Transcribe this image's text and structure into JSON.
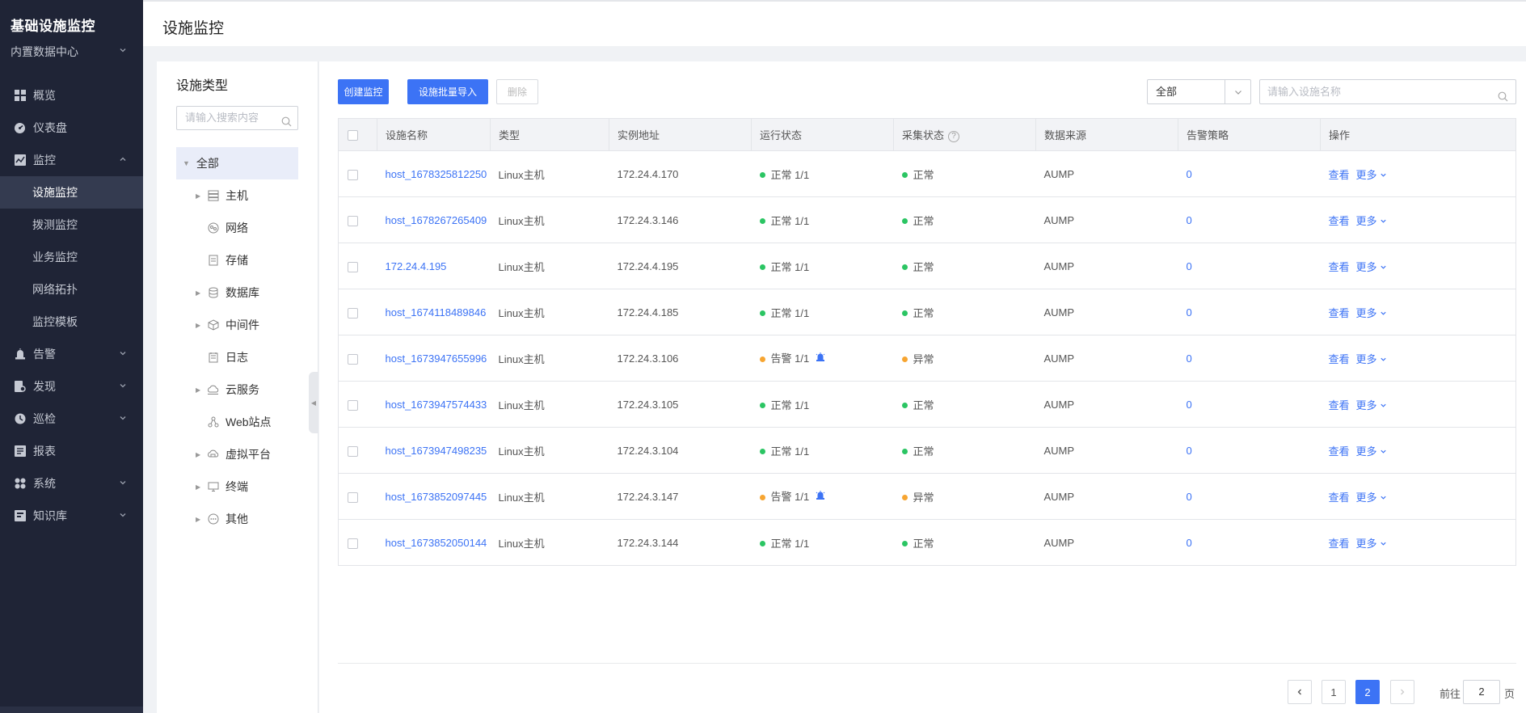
{
  "sidebar": {
    "title": "基础设施监控",
    "datacenter": "内置数据中心",
    "items": [
      {
        "label": "概览",
        "icon": "grid-icon",
        "expandable": false
      },
      {
        "label": "仪表盘",
        "icon": "dashboard-icon",
        "expandable": false
      },
      {
        "label": "监控",
        "icon": "monitor-chart-icon",
        "expandable": true,
        "open": true
      },
      {
        "label": "告警",
        "icon": "alarm-light-icon",
        "expandable": true
      },
      {
        "label": "发现",
        "icon": "discover-icon",
        "expandable": true
      },
      {
        "label": "巡检",
        "icon": "inspect-icon",
        "expandable": true
      },
      {
        "label": "报表",
        "icon": "report-icon",
        "expandable": false
      },
      {
        "label": "系统",
        "icon": "system-icon",
        "expandable": true
      },
      {
        "label": "知识库",
        "icon": "knowledge-icon",
        "expandable": true
      }
    ],
    "monitor_sub": [
      "设施监控",
      "拨测监控",
      "业务监控",
      "网络拓扑",
      "监控模板"
    ],
    "active_sub": "设施监控"
  },
  "header": {
    "title": "设施监控"
  },
  "tree": {
    "title": "设施类型",
    "search_placeholder": "请输入搜索内容",
    "root": "全部",
    "nodes": [
      {
        "label": "主机",
        "icon": "server-icon",
        "expandable": true
      },
      {
        "label": "网络",
        "icon": "network-icon",
        "expandable": false
      },
      {
        "label": "存储",
        "icon": "storage-icon",
        "expandable": false
      },
      {
        "label": "数据库",
        "icon": "database-icon",
        "expandable": true
      },
      {
        "label": "中间件",
        "icon": "middleware-icon",
        "expandable": true
      },
      {
        "label": "日志",
        "icon": "log-icon",
        "expandable": false
      },
      {
        "label": "云服务",
        "icon": "cloud-icon",
        "expandable": true
      },
      {
        "label": "Web站点",
        "icon": "web-site-icon",
        "expandable": false
      },
      {
        "label": "虚拟平台",
        "icon": "virtual-platform-icon",
        "expandable": true
      },
      {
        "label": "终端",
        "icon": "terminal-icon",
        "expandable": true
      },
      {
        "label": "其他",
        "icon": "more-dots-icon",
        "expandable": true
      }
    ]
  },
  "toolbar": {
    "create_label": "创建监控",
    "import_label": "设施批量导入",
    "delete_label": "删除",
    "filter_value": "全部",
    "search_placeholder": "请输入设施名称"
  },
  "table": {
    "columns": [
      "设施名称",
      "类型",
      "实例地址",
      "运行状态",
      "采集状态",
      "数据来源",
      "告警策略",
      "操作"
    ],
    "view_label": "查看",
    "more_label": "更多",
    "rows": [
      {
        "name": "host_1678325812250",
        "type": "Linux主机",
        "address": "172.24.4.170",
        "run_status": "正常 1/1",
        "run_level": "ok",
        "collect_status": "正常",
        "collect_level": "ok",
        "source": "AUMP",
        "policy": "0"
      },
      {
        "name": "host_1678267265409",
        "type": "Linux主机",
        "address": "172.24.3.146",
        "run_status": "正常 1/1",
        "run_level": "ok",
        "collect_status": "正常",
        "collect_level": "ok",
        "source": "AUMP",
        "policy": "0"
      },
      {
        "name": "172.24.4.195",
        "type": "Linux主机",
        "address": "172.24.4.195",
        "run_status": "正常 1/1",
        "run_level": "ok",
        "collect_status": "正常",
        "collect_level": "ok",
        "source": "AUMP",
        "policy": "0"
      },
      {
        "name": "host_1674118489846",
        "type": "Linux主机",
        "address": "172.24.4.185",
        "run_status": "正常 1/1",
        "run_level": "ok",
        "collect_status": "正常",
        "collect_level": "ok",
        "source": "AUMP",
        "policy": "0"
      },
      {
        "name": "host_1673947655996",
        "type": "Linux主机",
        "address": "172.24.3.106",
        "run_status": "告警 1/1",
        "run_level": "warn",
        "collect_status": "异常",
        "collect_level": "warn",
        "source": "AUMP",
        "policy": "0"
      },
      {
        "name": "host_1673947574433",
        "type": "Linux主机",
        "address": "172.24.3.105",
        "run_status": "正常 1/1",
        "run_level": "ok",
        "collect_status": "正常",
        "collect_level": "ok",
        "source": "AUMP",
        "policy": "0"
      },
      {
        "name": "host_1673947498235",
        "type": "Linux主机",
        "address": "172.24.3.104",
        "run_status": "正常 1/1",
        "run_level": "ok",
        "collect_status": "正常",
        "collect_level": "ok",
        "source": "AUMP",
        "policy": "0"
      },
      {
        "name": "host_1673852097445",
        "type": "Linux主机",
        "address": "172.24.3.147",
        "run_status": "告警 1/1",
        "run_level": "warn",
        "collect_status": "异常",
        "collect_level": "warn",
        "source": "AUMP",
        "policy": "0"
      },
      {
        "name": "host_1673852050144",
        "type": "Linux主机",
        "address": "172.24.3.144",
        "run_status": "正常 1/1",
        "run_level": "ok",
        "collect_status": "正常",
        "collect_level": "ok",
        "source": "AUMP",
        "policy": "0"
      }
    ]
  },
  "pagination": {
    "pages": [
      "1",
      "2"
    ],
    "current": "2",
    "goto_prefix": "前往",
    "goto_value": "2",
    "goto_suffix": "页"
  },
  "colors": {
    "primary": "#3c73f5",
    "ok": "#2bc563",
    "warn": "#f7a531",
    "sidebar_bg": "#1f2436"
  }
}
